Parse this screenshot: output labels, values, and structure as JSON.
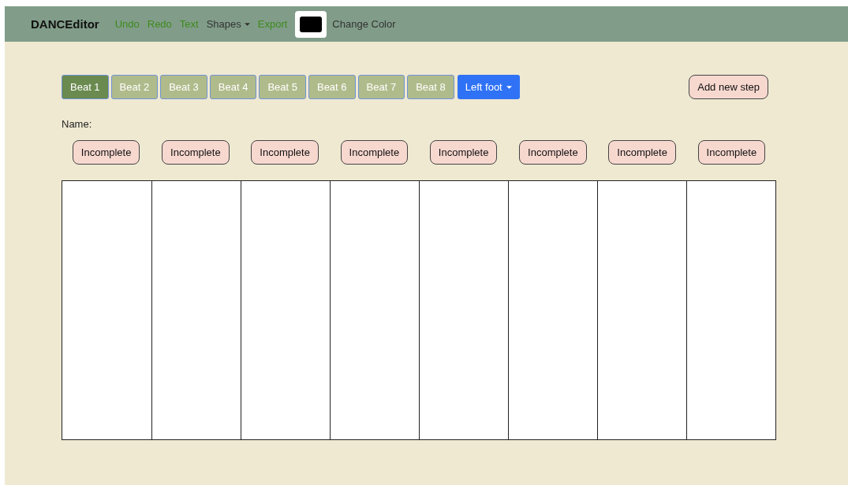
{
  "navbar": {
    "brand": "DANCEditor",
    "items": [
      {
        "kind": "link",
        "label": "Undo"
      },
      {
        "kind": "link",
        "label": "Redo"
      },
      {
        "kind": "link",
        "label": "Text"
      },
      {
        "kind": "dropdown",
        "label": "Shapes"
      },
      {
        "kind": "link",
        "label": "Export"
      }
    ],
    "color_swatch": {
      "color": "#000000"
    },
    "color_label": "Change Color"
  },
  "beats": [
    {
      "label": "Beat 1",
      "selected": true
    },
    {
      "label": "Beat 2",
      "selected": false
    },
    {
      "label": "Beat 3",
      "selected": false
    },
    {
      "label": "Beat 4",
      "selected": false
    },
    {
      "label": "Beat 5",
      "selected": false
    },
    {
      "label": "Beat 6",
      "selected": false
    },
    {
      "label": "Beat 7",
      "selected": false
    },
    {
      "label": "Beat 8",
      "selected": false
    }
  ],
  "foot_dropdown": "Left foot",
  "add_step": "Add new step",
  "name_label": "Name:",
  "steps": [
    {
      "status": "Incomplete"
    },
    {
      "status": "Incomplete"
    },
    {
      "status": "Incomplete"
    },
    {
      "status": "Incomplete"
    },
    {
      "status": "Incomplete"
    },
    {
      "status": "Incomplete"
    },
    {
      "status": "Incomplete"
    },
    {
      "status": "Incomplete"
    }
  ]
}
